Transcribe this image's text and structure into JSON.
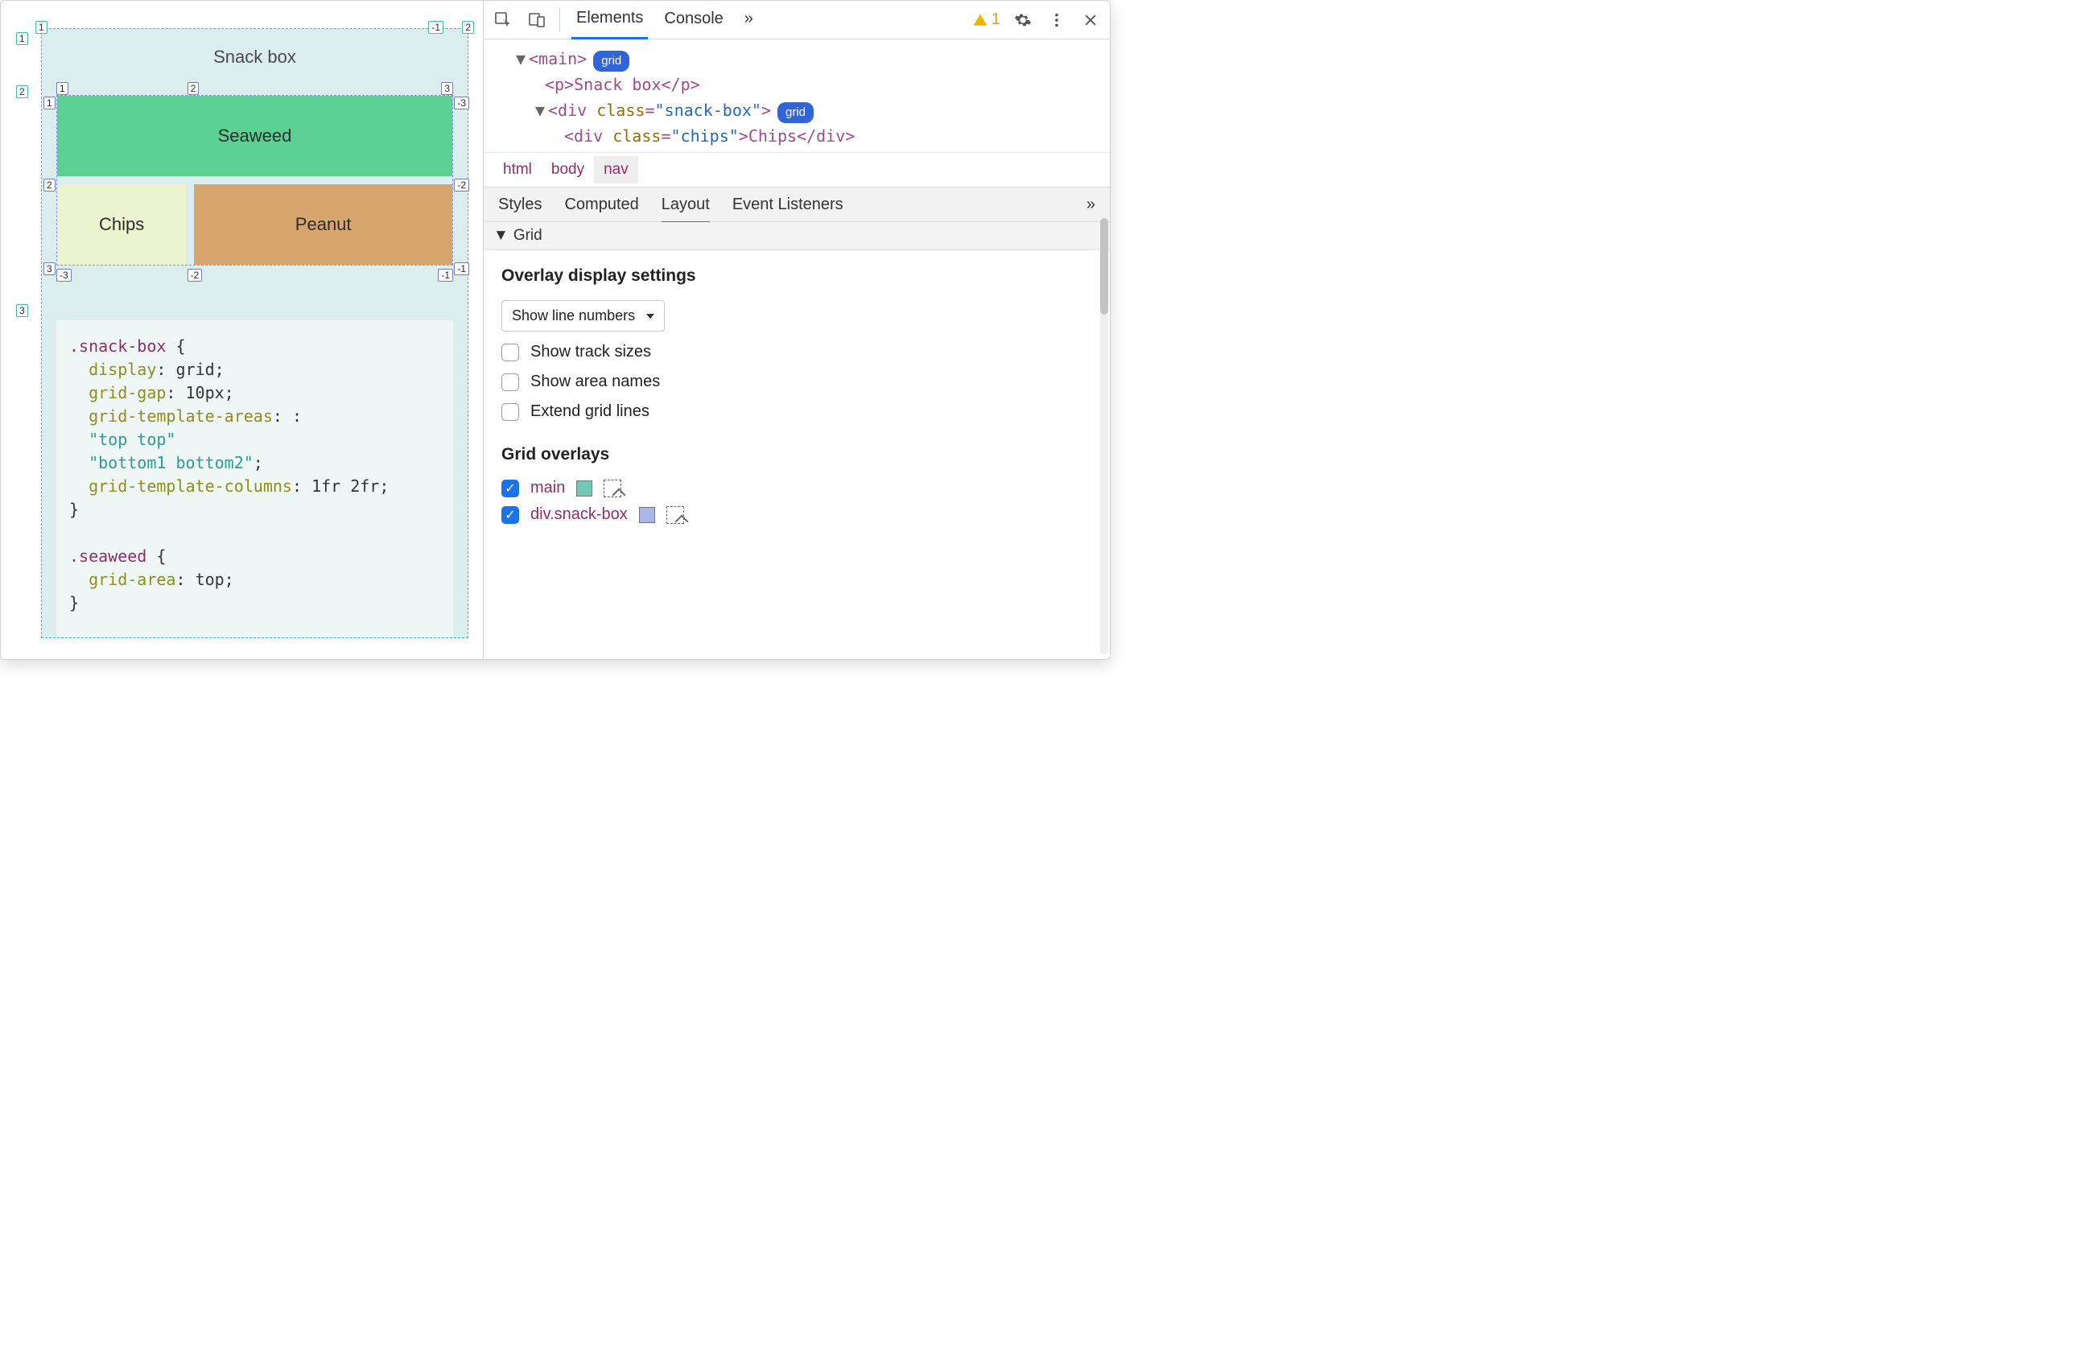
{
  "viewport": {
    "page_title": "Snack box",
    "snack": {
      "seaweed": "Seaweed",
      "chips": "Chips",
      "peanut": "Peanut"
    },
    "outer_grid_labels": {
      "top_left": "1",
      "top_right": "-1",
      "row2_left": "2",
      "row3_left": "3",
      "col2_right": "2"
    },
    "inner_grid_labels": {
      "top_cols": [
        "1",
        "2",
        "3"
      ],
      "left_rows": [
        "1",
        "2",
        "3"
      ],
      "right_rows_neg": [
        "-3",
        "-2",
        "-1"
      ],
      "bottom_cols_neg": [
        "-3",
        "-2",
        "-1"
      ]
    },
    "css_code_lines": [
      {
        "sel": ".snack-box",
        "open": " {"
      },
      {
        "prop": "display",
        "val": "grid;"
      },
      {
        "prop": "grid-gap",
        "val": "10px;"
      },
      {
        "prop": "grid-template-areas",
        "val": ":"
      },
      {
        "str": "\"top top\""
      },
      {
        "str": "\"bottom1 bottom2\"",
        "tail": ";"
      },
      {
        "prop": "grid-template-columns",
        "val": "1fr 2fr;"
      },
      {
        "close": "}"
      },
      {
        "blank": true
      },
      {
        "sel": ".seaweed",
        "open": " {"
      },
      {
        "prop": "grid-area",
        "val": "top;"
      },
      {
        "close": "}"
      }
    ]
  },
  "devtools": {
    "tabs": {
      "elements": "Elements",
      "console": "Console",
      "more": "»"
    },
    "warning_count": "1",
    "dom": {
      "main_open": "<main>",
      "main_badge": "grid",
      "p_line": "<p>Snack box</p>",
      "div_open_prefix": "<div ",
      "div_attr_name": "class",
      "div_attr_val": "\"snack-box\"",
      "div_open_suffix": ">",
      "div_badge": "grid",
      "child_prefix": "<div ",
      "child_attr_name": "class",
      "child_attr_val": "\"chips\"",
      "child_text": ">Chips</div>"
    },
    "breadcrumb": [
      "html",
      "body",
      "nav"
    ],
    "subtabs": {
      "styles": "Styles",
      "computed": "Computed",
      "layout": "Layout",
      "events": "Event Listeners",
      "more": "»"
    },
    "grid_section": {
      "title": "Grid",
      "settings_heading": "Overlay display settings",
      "dropdown_selected": "Show line numbers",
      "track_sizes": "Show track sizes",
      "area_names": "Show area names",
      "extend_lines": "Extend grid lines",
      "overlays_heading": "Grid overlays",
      "overlay_main": "main",
      "overlay_box": "div.snack-box"
    }
  }
}
